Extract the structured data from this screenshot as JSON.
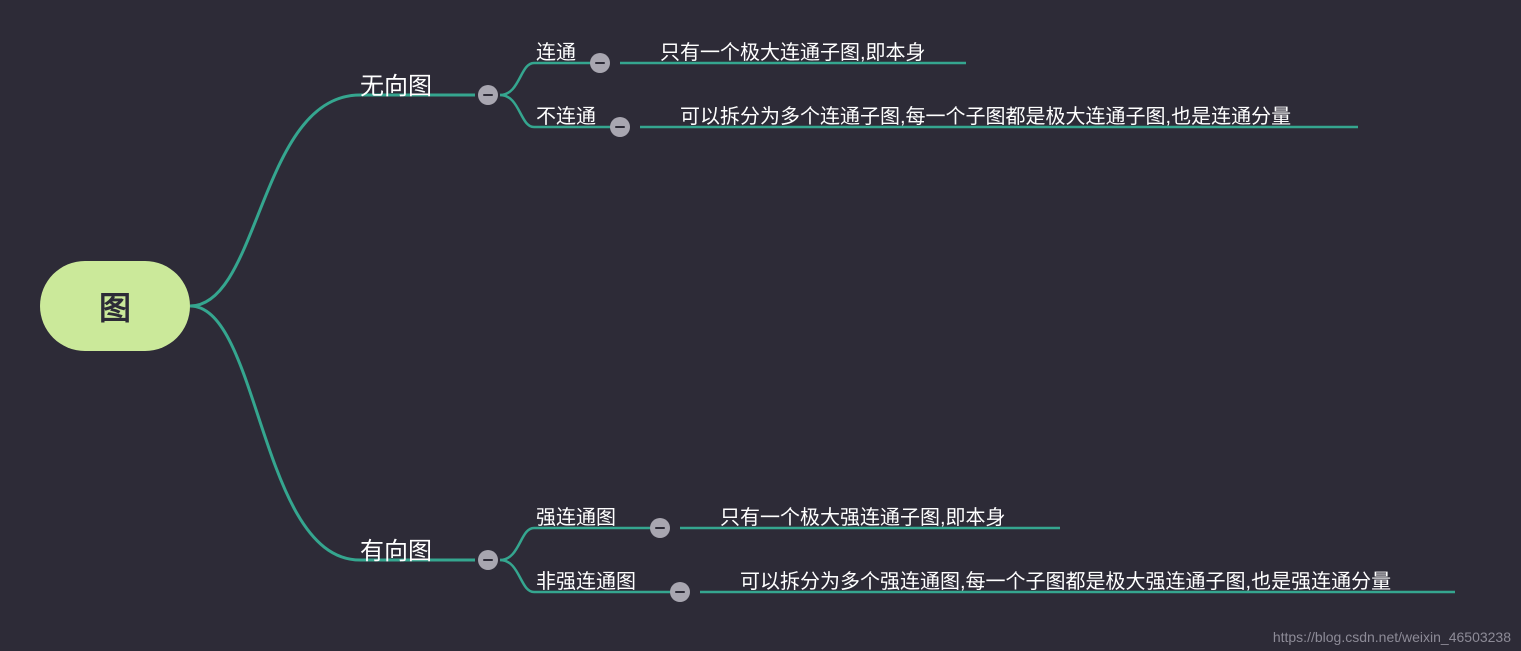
{
  "root": {
    "label": "图"
  },
  "branches": [
    {
      "id": "undirected",
      "label": "无向图",
      "children": [
        {
          "id": "connected",
          "label": "连通",
          "desc": "只有一个极大连通子图,即本身"
        },
        {
          "id": "disconnected",
          "label": "不连通",
          "desc": "可以拆分为多个连通子图,每一个子图都是极大连通子图,也是连通分量"
        }
      ]
    },
    {
      "id": "directed",
      "label": "有向图",
      "children": [
        {
          "id": "strongly",
          "label": "强连通图",
          "desc": "只有一个极大强连通子图,即本身"
        },
        {
          "id": "not-strongly",
          "label": "非强连通图",
          "desc": "可以拆分为多个强连通图,每一个子图都是极大强连通子图,也是强连通分量"
        }
      ]
    }
  ],
  "watermark": "https://blog.csdn.net/weixin_46503238",
  "colors": {
    "line": "#35a68f",
    "bg": "#2d2b37",
    "root": "#cbe99a"
  }
}
